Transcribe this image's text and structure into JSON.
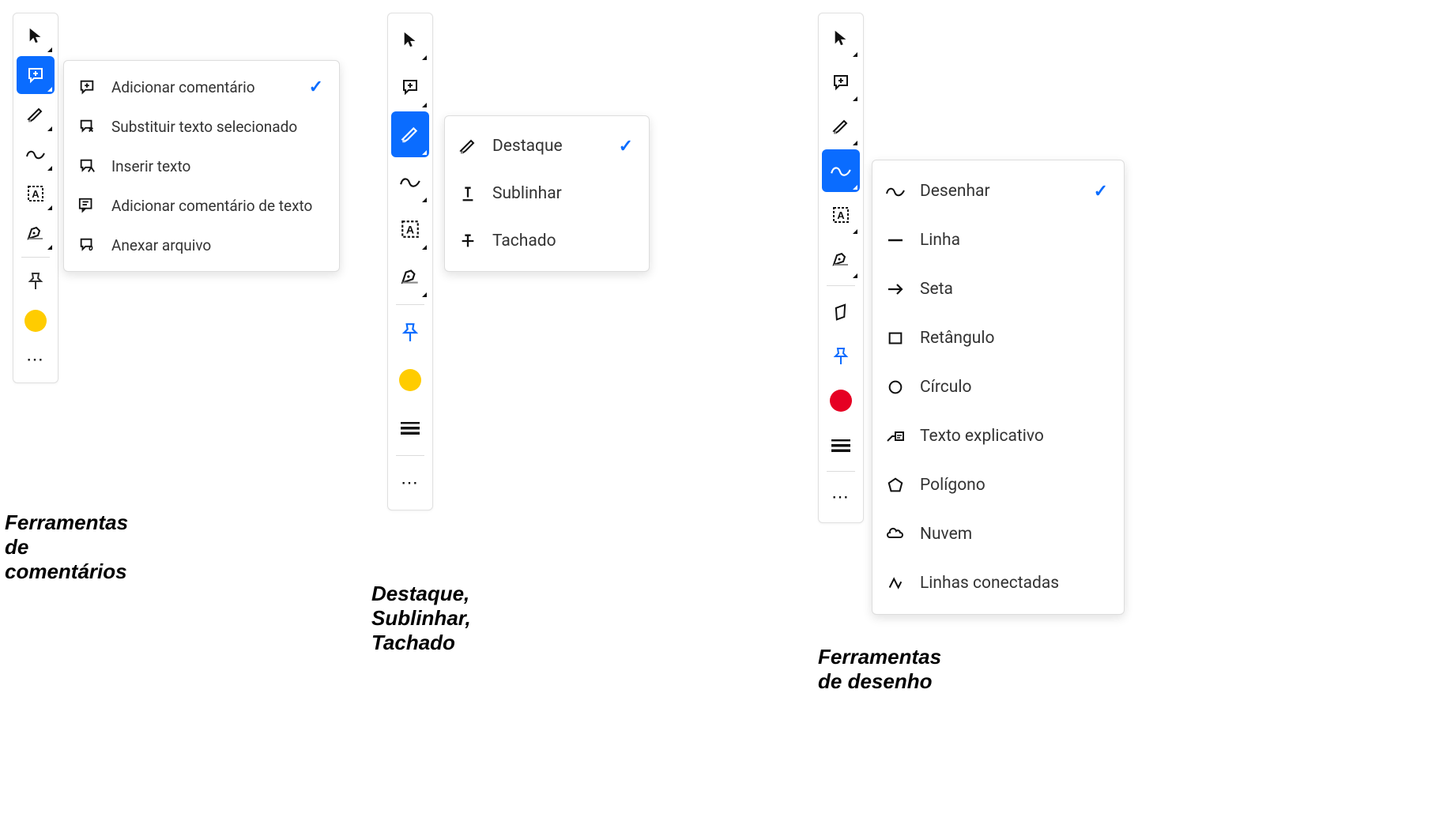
{
  "group1": {
    "caption": "Ferramentas de comentários",
    "toolbar": {
      "swatch_color": "#ffcc00",
      "pin_color": "#333333"
    },
    "flyout": {
      "items": [
        {
          "label": "Adicionar comentário",
          "checked": true
        },
        {
          "label": "Substituir texto selecionado"
        },
        {
          "label": "Inserir texto"
        },
        {
          "label": "Adicionar comentário de texto"
        },
        {
          "label": "Anexar arquivo"
        }
      ]
    }
  },
  "group2": {
    "caption": "Destaque, Sublinhar, Tachado",
    "toolbar": {
      "swatch_color": "#ffcc00",
      "pin_color": "#0a6cff"
    },
    "flyout": {
      "items": [
        {
          "label": "Destaque",
          "checked": true
        },
        {
          "label": "Sublinhar"
        },
        {
          "label": "Tachado"
        }
      ]
    }
  },
  "group3": {
    "caption": "Ferramentas de desenho",
    "toolbar": {
      "swatch_color": "#e60023",
      "pin_color": "#0a6cff"
    },
    "flyout": {
      "items": [
        {
          "label": "Desenhar",
          "checked": true
        },
        {
          "label": "Linha"
        },
        {
          "label": "Seta"
        },
        {
          "label": "Retângulo"
        },
        {
          "label": "Círculo"
        },
        {
          "label": "Texto explicativo"
        },
        {
          "label": "Polígono"
        },
        {
          "label": "Nuvem"
        },
        {
          "label": "Linhas conectadas"
        }
      ]
    }
  }
}
